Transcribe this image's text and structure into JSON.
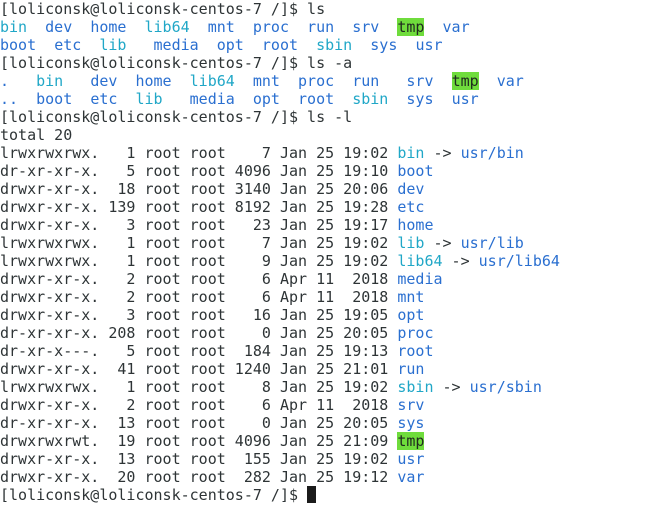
{
  "colors": {
    "background": "#ffffff",
    "text": "#2e3436",
    "directory": "#2a6fd0",
    "symlink": "#20a7c7",
    "sticky_bg": "#6fdc3c"
  },
  "terminal": {
    "lines": [
      [
        {
          "t": "[loliconsk@loliconsk-centos-7 /]$ ls",
          "c": "plain"
        }
      ],
      [
        {
          "t": "bin",
          "c": "link"
        },
        {
          "t": "  ",
          "c": "plain"
        },
        {
          "t": "dev",
          "c": "dir"
        },
        {
          "t": "  ",
          "c": "plain"
        },
        {
          "t": "home",
          "c": "dir"
        },
        {
          "t": "  ",
          "c": "plain"
        },
        {
          "t": "lib64",
          "c": "link"
        },
        {
          "t": "  ",
          "c": "plain"
        },
        {
          "t": "mnt",
          "c": "dir"
        },
        {
          "t": "  ",
          "c": "plain"
        },
        {
          "t": "proc",
          "c": "dir"
        },
        {
          "t": "  ",
          "c": "plain"
        },
        {
          "t": "run",
          "c": "dir"
        },
        {
          "t": "  ",
          "c": "plain"
        },
        {
          "t": "srv",
          "c": "dir"
        },
        {
          "t": "  ",
          "c": "plain"
        },
        {
          "t": "tmp",
          "c": "sticky"
        },
        {
          "t": "  ",
          "c": "plain"
        },
        {
          "t": "var",
          "c": "dir"
        }
      ],
      [
        {
          "t": "boot",
          "c": "dir"
        },
        {
          "t": "  ",
          "c": "plain"
        },
        {
          "t": "etc",
          "c": "dir"
        },
        {
          "t": "  ",
          "c": "plain"
        },
        {
          "t": "lib",
          "c": "link"
        },
        {
          "t": "   ",
          "c": "plain"
        },
        {
          "t": "media",
          "c": "dir"
        },
        {
          "t": "  ",
          "c": "plain"
        },
        {
          "t": "opt",
          "c": "dir"
        },
        {
          "t": "  ",
          "c": "plain"
        },
        {
          "t": "root",
          "c": "dir"
        },
        {
          "t": "  ",
          "c": "plain"
        },
        {
          "t": "sbin",
          "c": "link"
        },
        {
          "t": "  ",
          "c": "plain"
        },
        {
          "t": "sys",
          "c": "dir"
        },
        {
          "t": "  ",
          "c": "plain"
        },
        {
          "t": "usr",
          "c": "dir"
        }
      ],
      [
        {
          "t": "[loliconsk@loliconsk-centos-7 /]$ ls -a",
          "c": "plain"
        }
      ],
      [
        {
          "t": ".",
          "c": "dir"
        },
        {
          "t": "   ",
          "c": "plain"
        },
        {
          "t": "bin",
          "c": "link"
        },
        {
          "t": "   ",
          "c": "plain"
        },
        {
          "t": "dev",
          "c": "dir"
        },
        {
          "t": "  ",
          "c": "plain"
        },
        {
          "t": "home",
          "c": "dir"
        },
        {
          "t": "  ",
          "c": "plain"
        },
        {
          "t": "lib64",
          "c": "link"
        },
        {
          "t": "  ",
          "c": "plain"
        },
        {
          "t": "mnt",
          "c": "dir"
        },
        {
          "t": "  ",
          "c": "plain"
        },
        {
          "t": "proc",
          "c": "dir"
        },
        {
          "t": "  ",
          "c": "plain"
        },
        {
          "t": "run",
          "c": "dir"
        },
        {
          "t": "   ",
          "c": "plain"
        },
        {
          "t": "srv",
          "c": "dir"
        },
        {
          "t": "  ",
          "c": "plain"
        },
        {
          "t": "tmp",
          "c": "sticky"
        },
        {
          "t": "  ",
          "c": "plain"
        },
        {
          "t": "var",
          "c": "dir"
        }
      ],
      [
        {
          "t": "..",
          "c": "dir"
        },
        {
          "t": "  ",
          "c": "plain"
        },
        {
          "t": "boot",
          "c": "dir"
        },
        {
          "t": "  ",
          "c": "plain"
        },
        {
          "t": "etc",
          "c": "dir"
        },
        {
          "t": "  ",
          "c": "plain"
        },
        {
          "t": "lib",
          "c": "link"
        },
        {
          "t": "   ",
          "c": "plain"
        },
        {
          "t": "media",
          "c": "dir"
        },
        {
          "t": "  ",
          "c": "plain"
        },
        {
          "t": "opt",
          "c": "dir"
        },
        {
          "t": "  ",
          "c": "plain"
        },
        {
          "t": "root",
          "c": "dir"
        },
        {
          "t": "  ",
          "c": "plain"
        },
        {
          "t": "sbin",
          "c": "link"
        },
        {
          "t": "  ",
          "c": "plain"
        },
        {
          "t": "sys",
          "c": "dir"
        },
        {
          "t": "  ",
          "c": "plain"
        },
        {
          "t": "usr",
          "c": "dir"
        }
      ],
      [
        {
          "t": "[loliconsk@loliconsk-centos-7 /]$ ls -l",
          "c": "plain"
        }
      ],
      [
        {
          "t": "total 20",
          "c": "plain"
        }
      ],
      [
        {
          "t": "lrwxrwxrwx.   1 root root    7 Jan 25 19:02 ",
          "c": "plain"
        },
        {
          "t": "bin",
          "c": "link"
        },
        {
          "t": " -> ",
          "c": "plain"
        },
        {
          "t": "usr/bin",
          "c": "dir"
        }
      ],
      [
        {
          "t": "dr-xr-xr-x.   5 root root 4096 Jan 25 19:10 ",
          "c": "plain"
        },
        {
          "t": "boot",
          "c": "dir"
        }
      ],
      [
        {
          "t": "drwxr-xr-x.  18 root root 3140 Jan 25 20:06 ",
          "c": "plain"
        },
        {
          "t": "dev",
          "c": "dir"
        }
      ],
      [
        {
          "t": "drwxr-xr-x. 139 root root 8192 Jan 25 19:28 ",
          "c": "plain"
        },
        {
          "t": "etc",
          "c": "dir"
        }
      ],
      [
        {
          "t": "drwxr-xr-x.   3 root root   23 Jan 25 19:17 ",
          "c": "plain"
        },
        {
          "t": "home",
          "c": "dir"
        }
      ],
      [
        {
          "t": "lrwxrwxrwx.   1 root root    7 Jan 25 19:02 ",
          "c": "plain"
        },
        {
          "t": "lib",
          "c": "link"
        },
        {
          "t": " -> ",
          "c": "plain"
        },
        {
          "t": "usr/lib",
          "c": "dir"
        }
      ],
      [
        {
          "t": "lrwxrwxrwx.   1 root root    9 Jan 25 19:02 ",
          "c": "plain"
        },
        {
          "t": "lib64",
          "c": "link"
        },
        {
          "t": " -> ",
          "c": "plain"
        },
        {
          "t": "usr/lib64",
          "c": "dir"
        }
      ],
      [
        {
          "t": "drwxr-xr-x.   2 root root    6 Apr 11  2018 ",
          "c": "plain"
        },
        {
          "t": "media",
          "c": "dir"
        }
      ],
      [
        {
          "t": "drwxr-xr-x.   2 root root    6 Apr 11  2018 ",
          "c": "plain"
        },
        {
          "t": "mnt",
          "c": "dir"
        }
      ],
      [
        {
          "t": "drwxr-xr-x.   3 root root   16 Jan 25 19:05 ",
          "c": "plain"
        },
        {
          "t": "opt",
          "c": "dir"
        }
      ],
      [
        {
          "t": "dr-xr-xr-x. 208 root root    0 Jan 25 20:05 ",
          "c": "plain"
        },
        {
          "t": "proc",
          "c": "dir"
        }
      ],
      [
        {
          "t": "dr-xr-x---.   5 root root  184 Jan 25 19:13 ",
          "c": "plain"
        },
        {
          "t": "root",
          "c": "dir"
        }
      ],
      [
        {
          "t": "drwxr-xr-x.  41 root root 1240 Jan 25 21:01 ",
          "c": "plain"
        },
        {
          "t": "run",
          "c": "dir"
        }
      ],
      [
        {
          "t": "lrwxrwxrwx.   1 root root    8 Jan 25 19:02 ",
          "c": "plain"
        },
        {
          "t": "sbin",
          "c": "link"
        },
        {
          "t": " -> ",
          "c": "plain"
        },
        {
          "t": "usr/sbin",
          "c": "dir"
        }
      ],
      [
        {
          "t": "drwxr-xr-x.   2 root root    6 Apr 11  2018 ",
          "c": "plain"
        },
        {
          "t": "srv",
          "c": "dir"
        }
      ],
      [
        {
          "t": "dr-xr-xr-x.  13 root root    0 Jan 25 20:05 ",
          "c": "plain"
        },
        {
          "t": "sys",
          "c": "dir"
        }
      ],
      [
        {
          "t": "drwxrwxrwt.  19 root root 4096 Jan 25 21:09 ",
          "c": "plain"
        },
        {
          "t": "tmp",
          "c": "sticky"
        }
      ],
      [
        {
          "t": "drwxr-xr-x.  13 root root  155 Jan 25 19:02 ",
          "c": "plain"
        },
        {
          "t": "usr",
          "c": "dir"
        }
      ],
      [
        {
          "t": "drwxr-xr-x.  20 root root  282 Jan 25 19:12 ",
          "c": "plain"
        },
        {
          "t": "var",
          "c": "dir"
        }
      ],
      [
        {
          "t": "[loliconsk@loliconsk-centos-7 /]$ ",
          "c": "plain"
        }
      ]
    ]
  }
}
